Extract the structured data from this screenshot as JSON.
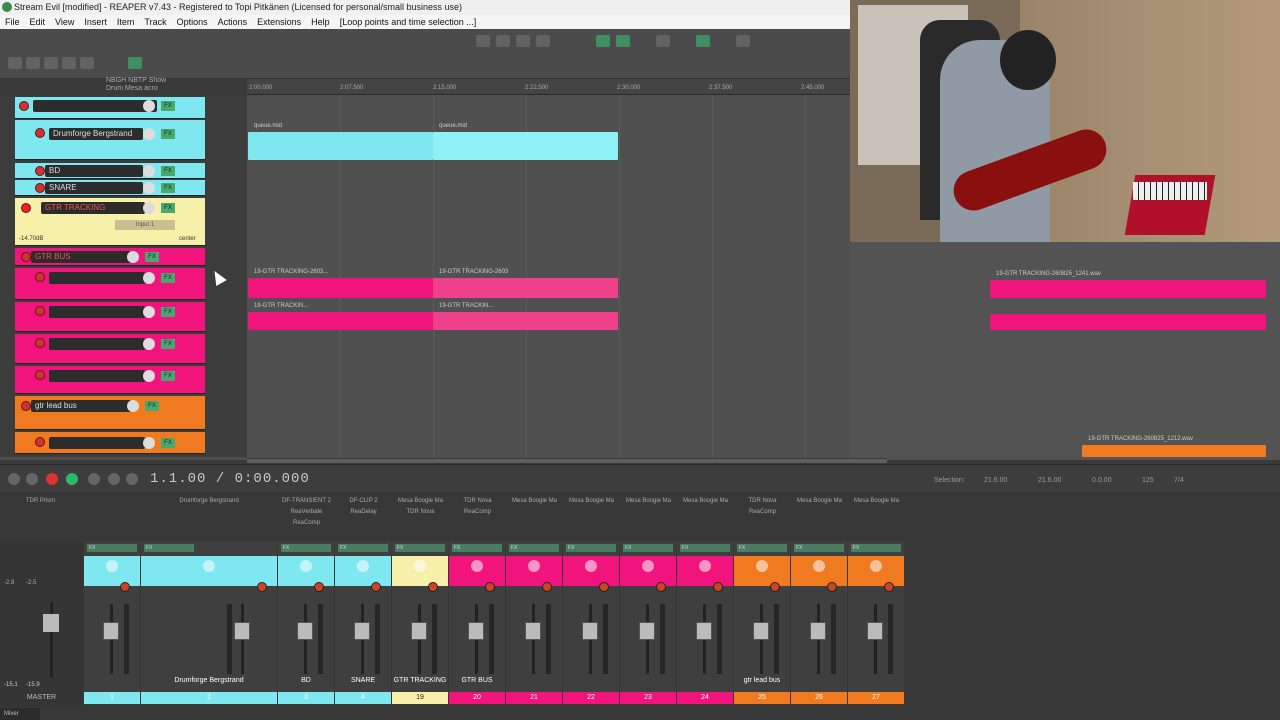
{
  "window": {
    "title": "Stream Evil [modified] - REAPER v7.43 - Registered to Topi Pitkänen (Licensed for personal/small business use)"
  },
  "menu": [
    "File",
    "Edit",
    "View",
    "Insert",
    "Item",
    "Track",
    "Options",
    "Actions",
    "Extensions",
    "Help",
    "[Loop points and time selection ...]"
  ],
  "tcp_info": {
    "line1": "NBGH NBTP Show",
    "line2": "Drum Mesa acro"
  },
  "tracks": [
    {
      "name": "",
      "color": "#7ee7f0"
    },
    {
      "name": "Drumforge Bergstrand",
      "color": "#7ee7f0"
    },
    {
      "name": "BD",
      "color": "#7ee7f0"
    },
    {
      "name": "SNARE",
      "color": "#7ee7f0"
    },
    {
      "name": "GTR TRACKING",
      "color": "#f7f0a8",
      "volume": "-14.70dB",
      "input": "Input 1",
      "pan": "center"
    },
    {
      "name": "GTR BUS",
      "color": "#f0147c"
    },
    {
      "name": "",
      "color": "#f0147c"
    },
    {
      "name": "",
      "color": "#f0147c"
    },
    {
      "name": "",
      "color": "#f0147c"
    },
    {
      "name": "",
      "color": "#f0147c"
    },
    {
      "name": "gtr lead bus",
      "color": "#f07a20"
    },
    {
      "name": "",
      "color": "#f07a20"
    }
  ],
  "clips": {
    "midi_a": "queue.mid",
    "midi_b": "queue.mid",
    "gtr1": "19-GTR TRACKING-2603...",
    "gtr2": "19-GTR TRACKIN...",
    "gtr3": "19-GTR TRACKING-2603",
    "gtr4": "19-GTR TRACKIN...",
    "gtr_r1": "19-GTR TRACKING-2603...",
    "gtr_r2": "19-GTR TRACKING-260825_1241.wav",
    "gtr_r3": "19-GTR TRACKING-260825_1212.wav"
  },
  "transport": {
    "time": "1.1.00 / 0:00.000",
    "selection_label": "Selection:",
    "sel_start": "21.6.00",
    "sel_end": "21.6.00",
    "sel_len": "0.0.00",
    "bpm": "125",
    "sig": "7/4"
  },
  "mixer": {
    "master": {
      "label": "MASTER",
      "db_l": "-2.8",
      "db_r": "-2.5",
      "peak_l": "-15.1",
      "peak_r": "-15.9"
    },
    "tab": "Mixer",
    "fx_labels": [
      "TDR Prism",
      "Drumforge Bergstrand",
      "DF-TRANSIENT 2\nReaVerbate\nReaComp",
      "DF-CLIP 2\nReaDelay",
      "Mesa Boogie Ma\nTDR Nova",
      "TDR Nova\nReaComp",
      "Mesa Boogie Ma",
      "Mesa Boogie Ma",
      "Mesa Boogie Ma",
      "Mesa Boogie Ma",
      "TDR Nova\nReaComp",
      "Mesa Boogie Ma",
      "Mesa Boogie Ma"
    ],
    "strips": [
      {
        "name": "",
        "num": "1",
        "color": "#7ee7f0"
      },
      {
        "name": "Drumforge Bergstrand",
        "num": "2",
        "color": "#7ee7f0"
      },
      {
        "name": "BD",
        "num": "3",
        "color": "#7ee7f0"
      },
      {
        "name": "SNARE",
        "num": "4",
        "color": "#7ee7f0"
      },
      {
        "name": "GTR TRACKING",
        "num": "19",
        "color": "#f7f0a8"
      },
      {
        "name": "GTR BUS",
        "num": "20",
        "color": "#f0147c"
      },
      {
        "name": "",
        "num": "21",
        "color": "#f0147c"
      },
      {
        "name": "",
        "num": "22",
        "color": "#f0147c"
      },
      {
        "name": "",
        "num": "23",
        "color": "#f0147c"
      },
      {
        "name": "",
        "num": "24",
        "color": "#f0147c"
      },
      {
        "name": "gtr lead bus",
        "num": "25",
        "color": "#f07a20"
      },
      {
        "name": "",
        "num": "26",
        "color": "#f07a20"
      },
      {
        "name": "",
        "num": "27",
        "color": "#f07a20"
      }
    ]
  },
  "ruler": [
    "2:00.000",
    "2:07.500",
    "2:15.000",
    "2:22.500",
    "2:30.000",
    "2:37.500",
    "2:45.000"
  ]
}
